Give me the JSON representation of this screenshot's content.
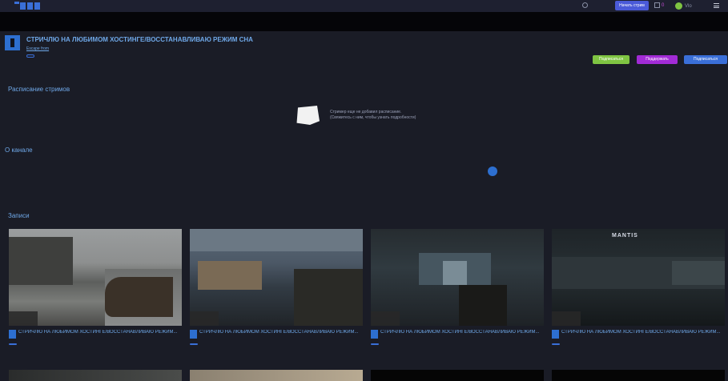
{
  "header": {
    "nav_items": [
      "",
      "",
      ""
    ],
    "start_stream_label": "Начать стрим",
    "wallet_amount": "0",
    "user_label": "Vlo"
  },
  "channel": {
    "title": "СТРИЧЛЮ НА ЛЮБИМОМ ХОСТИНГЕ/ВОССТАНАВЛИВАЮ РЕЖИМ СНА",
    "subtitle_link": "Escape from",
    "subtitle_rest": "",
    "meta_left": "",
    "meta_pill": ""
  },
  "actions": {
    "follow": "Подписаться",
    "support": "Поддержать",
    "subscribe": "Подписаться"
  },
  "schedule": {
    "heading": "Расписание стримов",
    "line1": "Стример еще не добавил расписание.",
    "line2": "(Свяжитесь с ним, чтобы узнать подробности)"
  },
  "about": {
    "heading": "О канале",
    "text": "",
    "icon_text": ""
  },
  "records": {
    "heading": "Записи",
    "items": [
      {
        "title": "СТРИЧЛЮ НА ЛЮБИМОМ ХОСТИНГЕ/ВОССТАНАВЛИВАЮ РЕЖИМ...",
        "sub": "",
        "meta_pill": ""
      },
      {
        "title": "СТРИЧЛЮ НА ЛЮБИМОМ ХОСТИНГЕ/ВОССТАНАВЛИВАЮ РЕЖИМ...",
        "sub": "",
        "meta_pill": ""
      },
      {
        "title": "СТРИЧЛЮ НА ЛЮБИМОМ ХОСТИНГЕ/ВОССТАНАВЛИВАЮ РЕЖИМ...",
        "sub": "",
        "meta_pill": ""
      },
      {
        "title": "СТРИЧЛЮ НА ЛЮБИМОМ ХОСТИНГЕ/ВОССТАНАВЛИВАЮ РЕЖИМ...",
        "sub": "",
        "meta_pill": ""
      }
    ],
    "thumb_text_4": "MANTIS"
  },
  "colors": {
    "background": "#1a1c26",
    "accent": "#6fa8e8",
    "follow_green": "#7fc442",
    "support_purple": "#a22bd6",
    "subscribe_blue": "#3a6fd8"
  }
}
